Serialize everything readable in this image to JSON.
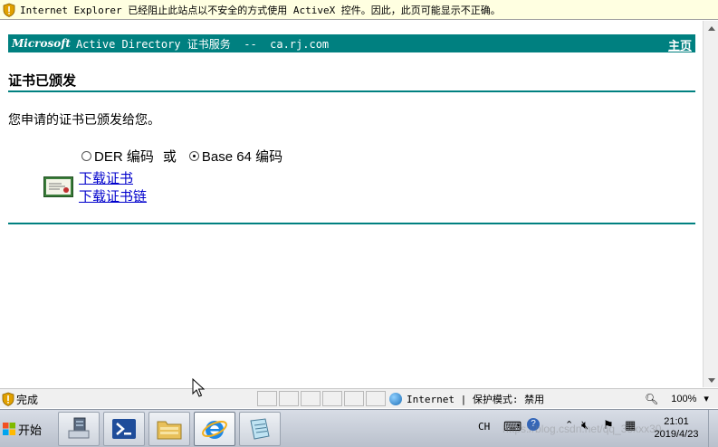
{
  "infobar": {
    "text": "Internet Explorer 已经阻止此站点以不安全的方式使用 ActiveX 控件。因此，此页可能显示不正确。",
    "icon": "shield-warning-icon"
  },
  "header": {
    "logo": "Microsoft",
    "title": "Active Directory 证书服务  --  ca.rj.com",
    "home_link": "主页"
  },
  "page": {
    "heading": "证书已颁发",
    "message": "您申请的证书已颁发给您。",
    "encoding": {
      "der_label": "DER 编码",
      "or_label": "或",
      "base64_label": "Base 64 编码",
      "selected": "Base 64 编码"
    },
    "links": {
      "download_cert": "下载证书",
      "download_chain": "下载证书链"
    }
  },
  "statusbar": {
    "status": "完成",
    "zone": "Internet | 保护模式: 禁用",
    "zoom": "100%"
  },
  "taskbar": {
    "start_label": "开始",
    "apps": [
      "server-manager-icon",
      "powershell-icon",
      "explorer-folder-icon",
      "internet-explorer-icon",
      "notepad-icon"
    ],
    "tray_language": "CH",
    "time": "21:01",
    "date": "2019/4/23"
  },
  "watermark": "https://blog.csdn.net/qq_38xxx30"
}
